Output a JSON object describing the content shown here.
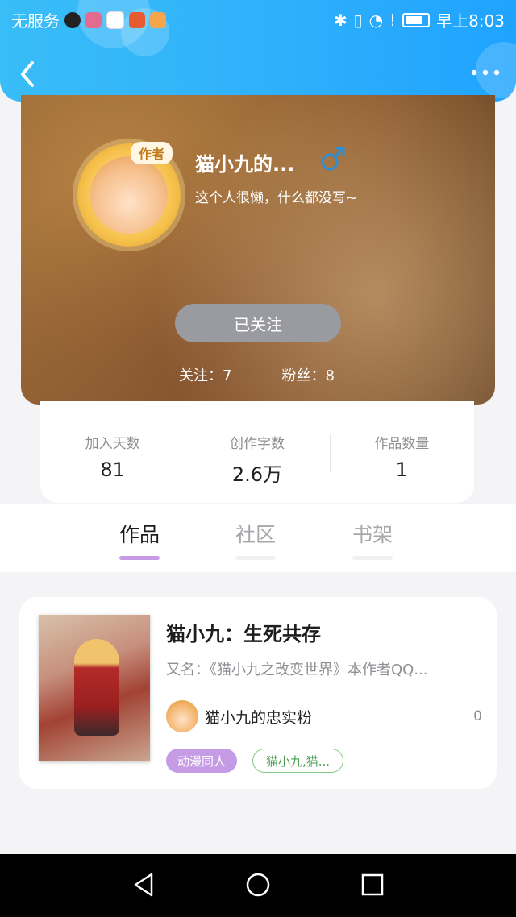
{
  "status_bar": {
    "carrier": "无服务",
    "time": "早上8:03"
  },
  "profile": {
    "author_badge": "作者",
    "name": "猫小九的...",
    "bio": "这个人很懒，什么都没写~",
    "follow_button": "已关注",
    "following_label": "关注：7",
    "fans_label": "粉丝：8"
  },
  "stats": [
    {
      "label": "加入天数",
      "value": "81"
    },
    {
      "label": "创作字数",
      "value": "2.6万"
    },
    {
      "label": "作品数量",
      "value": "1"
    }
  ],
  "tabs": [
    {
      "label": "作品",
      "active": true
    },
    {
      "label": "社区",
      "active": false
    },
    {
      "label": "书架",
      "active": false
    }
  ],
  "work": {
    "title": "猫小九：生死共存",
    "alias": "又名：《猫小九之改变世界》本作者QQ...",
    "author": "猫小九的忠实粉",
    "count": "0",
    "tags": [
      "动漫同人",
      "猫小九,猫..."
    ]
  },
  "colors": {
    "header": "#2fb0fb",
    "tab_underline": "#c69be6",
    "tag_fill": "#c69be6",
    "tag_outline": "#7fc884"
  }
}
